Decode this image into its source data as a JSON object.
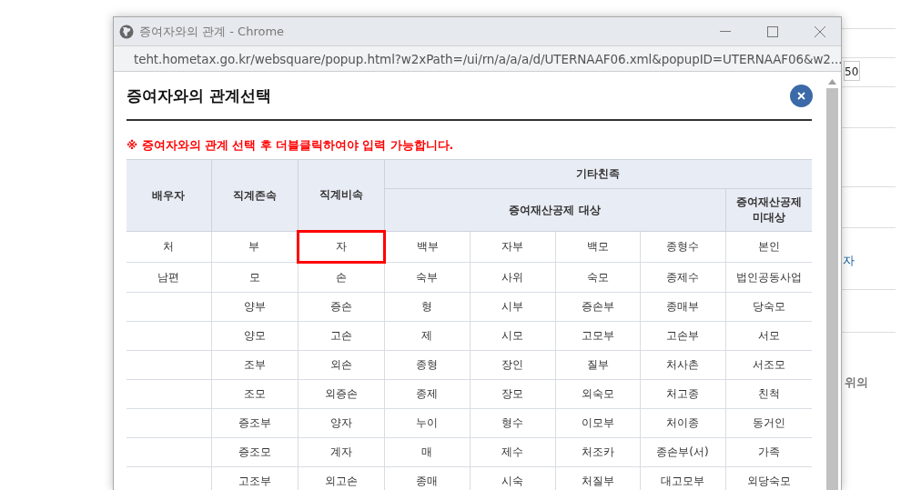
{
  "background_page": {
    "field_value": "50",
    "link_fragment": "자",
    "label_fragment": "위의"
  },
  "window": {
    "title": "증여자와의 관계 - Chrome",
    "url": "teht.hometax.go.kr/websquare/popup.html?w2xPath=/ui/rn/a/a/a/d/UTERNAAF06.xml&popupID=UTERNAAF06&w2..."
  },
  "dialog": {
    "title": "증여자와의 관계선택",
    "notice": "※ 증여자와의 관계 선택 후 더블클릭하여야 입력 가능합니다."
  },
  "table": {
    "columns": [
      {
        "label": "배우자"
      },
      {
        "label": "직계존속"
      },
      {
        "label": "직계비속"
      }
    ],
    "group": {
      "label": "기타친족",
      "subgroups": [
        {
          "label": "증여재산공제 대상"
        },
        {
          "label": "증여재산공제 미대상"
        }
      ]
    },
    "rows": [
      [
        {
          "text": "처",
          "selected": false
        },
        {
          "text": "부",
          "selected": false
        },
        {
          "text": "자",
          "selected": true
        },
        {
          "text": "백부",
          "selected": false
        },
        {
          "text": "자부",
          "selected": false
        },
        {
          "text": "백모",
          "selected": false
        },
        {
          "text": "종형수",
          "selected": false
        },
        {
          "text": "본인",
          "selected": false
        }
      ],
      [
        {
          "text": "남편",
          "selected": false
        },
        {
          "text": "모",
          "selected": false
        },
        {
          "text": "손",
          "selected": false
        },
        {
          "text": "숙부",
          "selected": false
        },
        {
          "text": "사위",
          "selected": false
        },
        {
          "text": "숙모",
          "selected": false
        },
        {
          "text": "종제수",
          "selected": false
        },
        {
          "text": "법인공동사업",
          "selected": false
        }
      ],
      [
        {
          "selected": false
        },
        {
          "text": "양부",
          "selected": false
        },
        {
          "text": "증손",
          "selected": false
        },
        {
          "text": "형",
          "selected": false
        },
        {
          "text": "시부",
          "selected": false
        },
        {
          "text": "증손부",
          "selected": false
        },
        {
          "text": "종매부",
          "selected": false
        },
        {
          "text": "당숙모",
          "selected": false
        }
      ],
      [
        {
          "selected": false
        },
        {
          "text": "양모",
          "selected": false
        },
        {
          "text": "고손",
          "selected": false
        },
        {
          "text": "제",
          "selected": false
        },
        {
          "text": "시모",
          "selected": false
        },
        {
          "text": "고모부",
          "selected": false
        },
        {
          "text": "고손부",
          "selected": false
        },
        {
          "text": "서모",
          "selected": false
        }
      ],
      [
        {
          "selected": false
        },
        {
          "text": "조부",
          "selected": false
        },
        {
          "text": "외손",
          "selected": false
        },
        {
          "text": "종형",
          "selected": false
        },
        {
          "text": "장인",
          "selected": false
        },
        {
          "text": "질부",
          "selected": false
        },
        {
          "text": "처사촌",
          "selected": false
        },
        {
          "text": "서조모",
          "selected": false
        }
      ],
      [
        {
          "selected": false
        },
        {
          "text": "조모",
          "selected": false
        },
        {
          "text": "외증손",
          "selected": false
        },
        {
          "text": "종제",
          "selected": false
        },
        {
          "text": "장모",
          "selected": false
        },
        {
          "text": "외숙모",
          "selected": false
        },
        {
          "text": "처고종",
          "selected": false
        },
        {
          "text": "친척",
          "selected": false
        }
      ],
      [
        {
          "selected": false
        },
        {
          "text": "증조부",
          "selected": false
        },
        {
          "text": "양자",
          "selected": false
        },
        {
          "text": "누이",
          "selected": false
        },
        {
          "text": "형수",
          "selected": false
        },
        {
          "text": "이모부",
          "selected": false
        },
        {
          "text": "처이종",
          "selected": false
        },
        {
          "text": "동거인",
          "selected": false
        }
      ],
      [
        {
          "selected": false
        },
        {
          "text": "증조모",
          "selected": false
        },
        {
          "text": "계자",
          "selected": false
        },
        {
          "text": "매",
          "selected": false
        },
        {
          "text": "제수",
          "selected": false
        },
        {
          "text": "처조카",
          "selected": false
        },
        {
          "text": "종손부(서)",
          "selected": false
        },
        {
          "text": "가족",
          "selected": false
        }
      ],
      [
        {
          "selected": false
        },
        {
          "text": "고조부",
          "selected": false
        },
        {
          "text": "외고손",
          "selected": false
        },
        {
          "text": "종매",
          "selected": false
        },
        {
          "text": "시숙",
          "selected": false
        },
        {
          "text": "처질부",
          "selected": false
        },
        {
          "text": "대고모부",
          "selected": false
        },
        {
          "text": "외당숙모",
          "selected": false
        }
      ]
    ]
  }
}
